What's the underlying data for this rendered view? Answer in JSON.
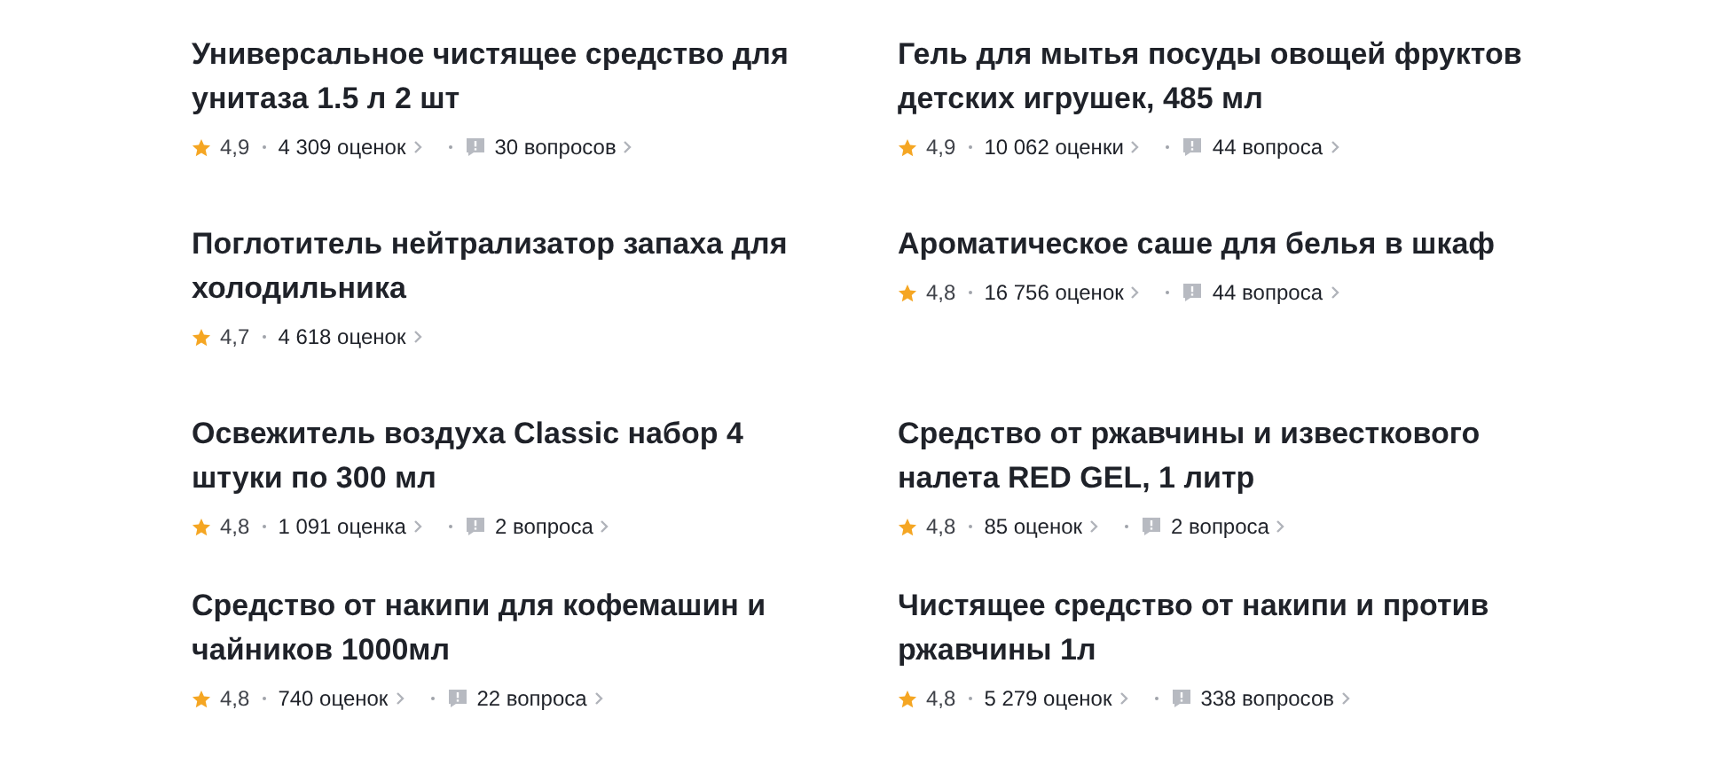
{
  "products": [
    {
      "title": "Универсальное чистящее средство для унитаза 1.5 л 2 шт",
      "rating": "4,9",
      "reviews": "4 309 оценок",
      "questions": "30 вопросов"
    },
    {
      "title": "Гель для мытья посуды овощей фруктов детских игрушек, 485 мл",
      "rating": "4,9",
      "reviews": "10 062 оценки",
      "questions": "44 вопроса"
    },
    {
      "title": "Поглотитель нейтрализатор запаха для холодильника",
      "rating": "4,7",
      "reviews": "4 618 оценок"
    },
    {
      "title": "Ароматическое саше для белья в шкаф",
      "rating": "4,8",
      "reviews": "16 756 оценок",
      "questions": "44 вопроса"
    },
    {
      "title": "Освежитель воздуха Classic набор 4 штуки по 300 мл",
      "rating": "4,8",
      "reviews": "1 091 оценка",
      "questions": "2 вопроса"
    },
    {
      "title": "Средство от ржавчины и известкового налета RED GEL, 1 литр",
      "rating": "4,8",
      "reviews": "85 оценок",
      "questions": "2 вопроса"
    },
    {
      "title": "Средство от накипи для кофемашин и чайников 1000мл",
      "rating": "4,8",
      "reviews": "740 оценок",
      "questions": "22 вопроса"
    },
    {
      "title": "Чистящее средство от накипи и против ржавчины 1л",
      "rating": "4,8",
      "reviews": "5 279 оценок",
      "questions": "338 вопросов"
    }
  ]
}
